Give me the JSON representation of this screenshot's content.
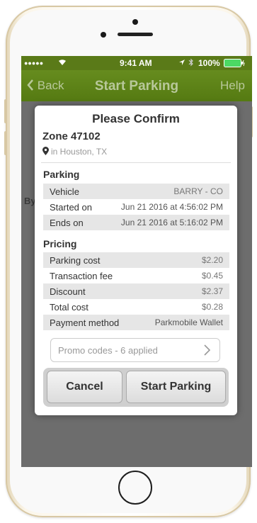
{
  "status_bar": {
    "signal": "●●●●● ",
    "time": "9:41 AM",
    "battery": "100%"
  },
  "nav": {
    "back_label": "Back",
    "title": "Start Parking",
    "help_label": "Help"
  },
  "background": {
    "partial_text": "By"
  },
  "modal": {
    "title": "Please Confirm",
    "zone": "Zone 47102",
    "location": "in Houston, TX",
    "parking_heading": "Parking",
    "parking_rows": [
      {
        "label": "Vehicle",
        "value": "BARRY - CO"
      },
      {
        "label": "Started on",
        "value": "Jun 21 2016 at 4:56:02 PM"
      },
      {
        "label": "Ends on",
        "value": "Jun 21 2016 at 5:16:02 PM"
      }
    ],
    "pricing_heading": "Pricing",
    "pricing_rows": [
      {
        "label": "Parking cost",
        "value": "$2.20"
      },
      {
        "label": "Transaction fee",
        "value": "$0.45"
      },
      {
        "label": "Discount",
        "value": "$2.37"
      },
      {
        "label": "Total cost",
        "value": "$0.28"
      },
      {
        "label": "Payment method",
        "value": "Parkmobile Wallet"
      }
    ],
    "promo_label": "Promo codes - 6 applied",
    "cancel_label": "Cancel",
    "start_label": "Start Parking"
  },
  "colors": {
    "nav_green": "#5e8418",
    "battery_green": "#4cd964"
  }
}
